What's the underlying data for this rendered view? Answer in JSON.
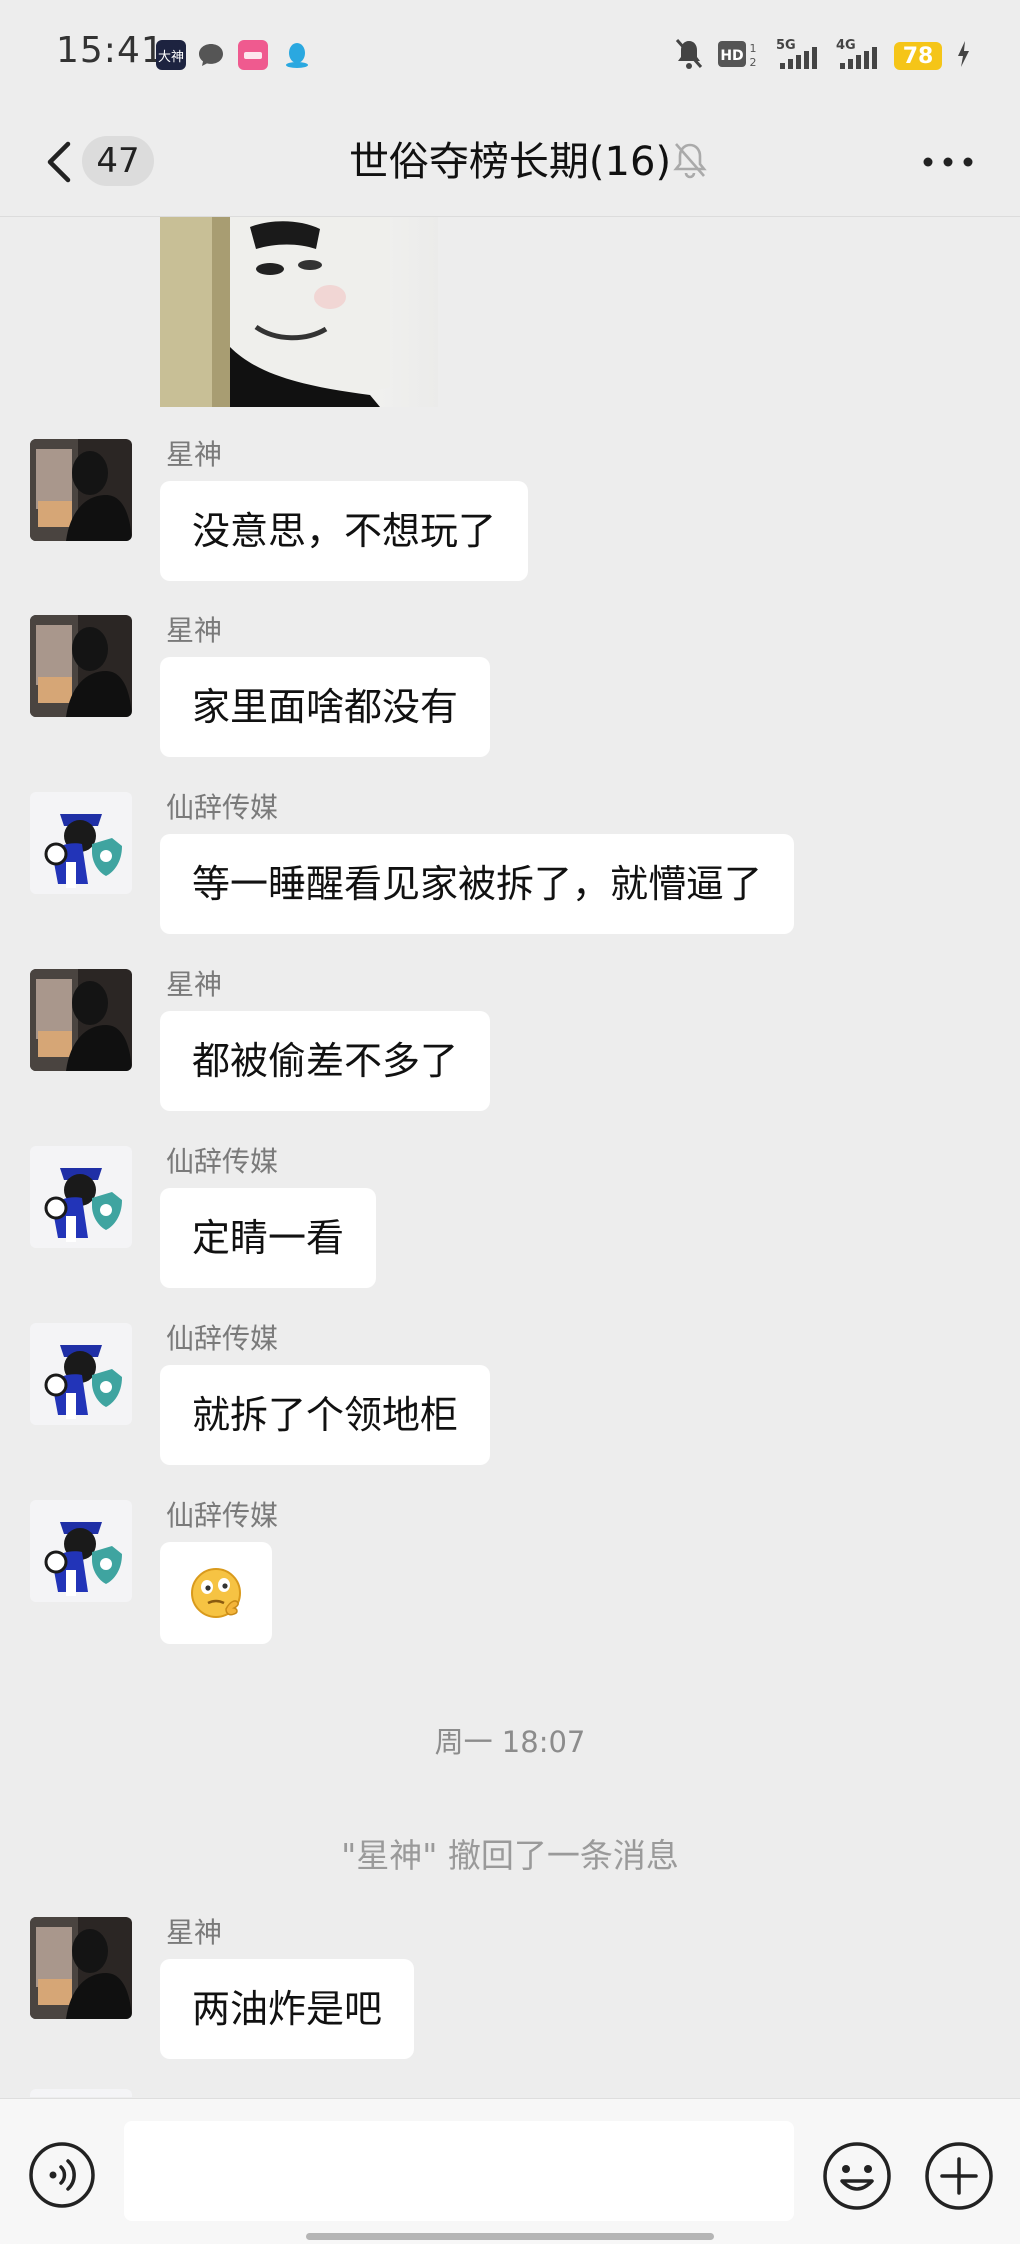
{
  "status_bar": {
    "time": "15:41",
    "app_icons": [
      "dashen-app-icon",
      "message-bubble-icon",
      "pink-app-icon",
      "qq-penguin-icon"
    ],
    "indicators": [
      "bell-muted-icon",
      "hd-icon",
      "5g-signal-icon",
      "4g-signal-icon"
    ],
    "battery": "78"
  },
  "header": {
    "unread_count": "47",
    "title": "世俗夺榜长期(16)"
  },
  "messages": [
    {
      "sender": "星神",
      "text": "没意思，不想玩了",
      "avatar": "xingshen"
    },
    {
      "sender": "星神",
      "text": "家里面啥都没有",
      "avatar": "xingshen"
    },
    {
      "sender": "仙辞传媒",
      "text": "等一睡醒看见家被拆了，就懵逼了",
      "avatar": "xianci"
    },
    {
      "sender": "星神",
      "text": "都被偷差不多了",
      "avatar": "xingshen"
    },
    {
      "sender": "仙辞传媒",
      "text": "定睛一看",
      "avatar": "xianci"
    },
    {
      "sender": "仙辞传媒",
      "text": "就拆了个领地柜",
      "avatar": "xianci"
    },
    {
      "sender": "仙辞传媒",
      "emoji": "🤔",
      "avatar": "xianci"
    }
  ],
  "timestamp": "周一 18:07",
  "system_note": "\"星神\" 撤回了一条消息",
  "last_message": {
    "sender": "星神",
    "text": "两油炸是吧",
    "avatar": "xingshen"
  },
  "input": {
    "value": "",
    "placeholder": ""
  },
  "colors": {
    "background": "#ededed",
    "bubble": "#ffffff",
    "battery": "#f5c518"
  }
}
